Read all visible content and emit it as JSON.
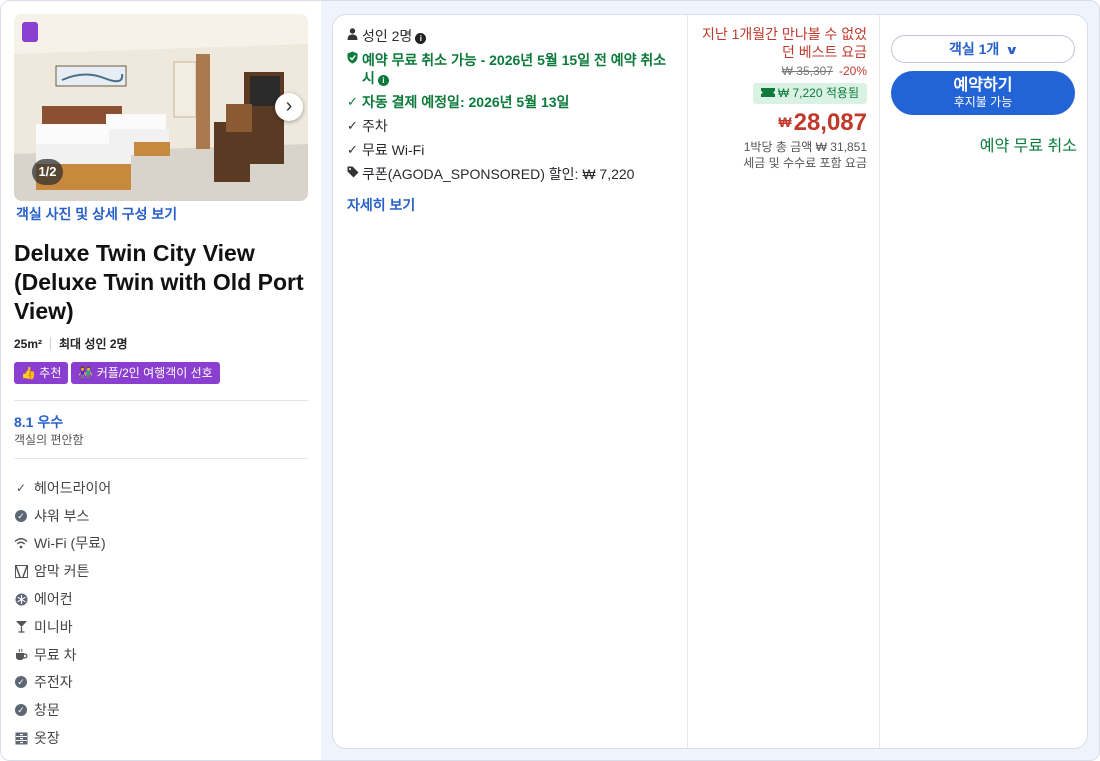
{
  "room": {
    "photo_counter": "1/2",
    "photo_link": "객실 사진 및 상세 구성 보기",
    "title": "Deluxe Twin City View (Deluxe Twin with Old Port View)",
    "size": "25m²",
    "max_guests": "최대 성인 2명",
    "badges": [
      {
        "label": "추천",
        "icon": "thumbs-up-icon"
      },
      {
        "label": "커플/2인 여행객이 선호",
        "icon": "couple-icon"
      }
    ],
    "score": "8.1 우수",
    "score_caption": "객실의 편안함",
    "amenities": [
      {
        "label": "헤어드라이어",
        "icon": "check-icon"
      },
      {
        "label": "샤워 부스",
        "icon": "check-circle-icon"
      },
      {
        "label": "Wi-Fi (무료)",
        "icon": "wifi-icon"
      },
      {
        "label": "암막 커튼",
        "icon": "curtain-icon"
      },
      {
        "label": "에어컨",
        "icon": "snowflake-icon"
      },
      {
        "label": "미니바",
        "icon": "cocktail-icon"
      },
      {
        "label": "무료 차",
        "icon": "tea-icon"
      },
      {
        "label": "주전자",
        "icon": "check-circle-icon"
      },
      {
        "label": "창문",
        "icon": "check-circle-icon"
      },
      {
        "label": "옷장",
        "icon": "wardrobe-icon"
      }
    ]
  },
  "benefits": {
    "guests": "성인 2명",
    "free_cancel": "예약 무료 취소 가능 - 2026년 5월 15일 전 예약 취소 시",
    "auto_pay": "자동 결제 예정일: 2026년 5월 13일",
    "parking": "주차",
    "wifi": "무료 Wi-Fi",
    "coupon": "쿠폰(AGODA_SPONSORED) 할인: ₩ 7,220",
    "details_link": "자세히 보기"
  },
  "price": {
    "deal_text": "지난 1개월간 만나볼 수 없었던 베스트 요금",
    "original": "₩ 35,307",
    "discount_pct": "-20%",
    "coupon_applied": "₩ 7,220 적용됨",
    "currency": "₩",
    "final": "28,087",
    "per_night_total": "1박당 총 금액 ₩ 31,851",
    "tax_note": "세금 및 수수료 포함 요금"
  },
  "actions": {
    "room_select": "객실 1개",
    "book_label": "예약하기",
    "book_sub": "후지불 가능",
    "free_cancel": "예약 무료 취소"
  },
  "colors": {
    "accent_blue": "#2264d6",
    "link_blue": "#2860c9",
    "badge_purple": "#8a3fd1",
    "green": "#0b7a3a",
    "red": "#c0392b"
  }
}
